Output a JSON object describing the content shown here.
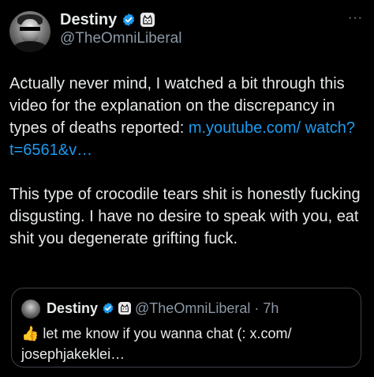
{
  "author": {
    "display_name": "Destiny",
    "handle": "@TheOmniLiberal",
    "avatar_icon": "profile-photo",
    "verified_icon": "verified-badge-icon",
    "affiliate_icon": "affiliate-badge-icon"
  },
  "more_label": "···",
  "tweet": {
    "paragraph1_text": "Actually never mind, I watched a bit through this video for the explanation on the discrepancy in types of deaths reported: ",
    "link_text": "m.youtube.com/ watch?t=6561&v…",
    "paragraph2_text": "This type of crocodile tears shit is honestly fucking disgusting. I have no desire to speak with you, eat shit you degenerate grifting fuck."
  },
  "quoted_tweet": {
    "display_name": "Destiny",
    "handle": "@TheOmniLiberal",
    "separator": "·",
    "time": "7h",
    "emoji": "👍",
    "text": " let me know if you wanna chat (: x.com/ josephjakeklei…"
  },
  "colors": {
    "background": "#000000",
    "text": "#e7e9ea",
    "secondary": "#8b98a5",
    "link": "#1d9bf0",
    "verified": "#1d9bf0"
  }
}
